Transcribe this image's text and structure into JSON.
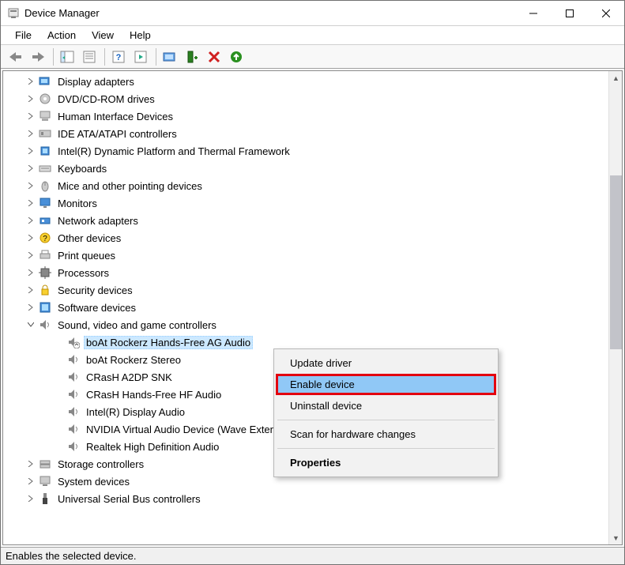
{
  "window": {
    "title": "Device Manager"
  },
  "menu": {
    "file": "File",
    "action": "Action",
    "view": "View",
    "help": "Help"
  },
  "tree": {
    "display_adapters": "Display adapters",
    "dvd": "DVD/CD-ROM drives",
    "hid": "Human Interface Devices",
    "ide": "IDE ATA/ATAPI controllers",
    "intel_dptf": "Intel(R) Dynamic Platform and Thermal Framework",
    "keyboards": "Keyboards",
    "mice": "Mice and other pointing devices",
    "monitors": "Monitors",
    "network": "Network adapters",
    "other": "Other devices",
    "print_queues": "Print queues",
    "processors": "Processors",
    "security": "Security devices",
    "software": "Software devices",
    "sound": "Sound, video and game controllers",
    "sound_children": {
      "boat_hf": "boAt Rockerz Hands-Free AG Audio",
      "boat_stereo": "boAt Rockerz Stereo",
      "crash_a2dp": "CRasH A2DP SNK",
      "crash_hf": "CRasH Hands-Free HF Audio",
      "intel_audio": "Intel(R) Display Audio",
      "nvidia": "NVIDIA Virtual Audio Device (Wave Extensible) (WDM)",
      "realtek": "Realtek High Definition Audio"
    },
    "storage": "Storage controllers",
    "system": "System devices",
    "usb": "Universal Serial Bus controllers"
  },
  "context_menu": {
    "update": "Update driver",
    "enable": "Enable device",
    "uninstall": "Uninstall device",
    "scan": "Scan for hardware changes",
    "properties": "Properties"
  },
  "status": "Enables the selected device."
}
